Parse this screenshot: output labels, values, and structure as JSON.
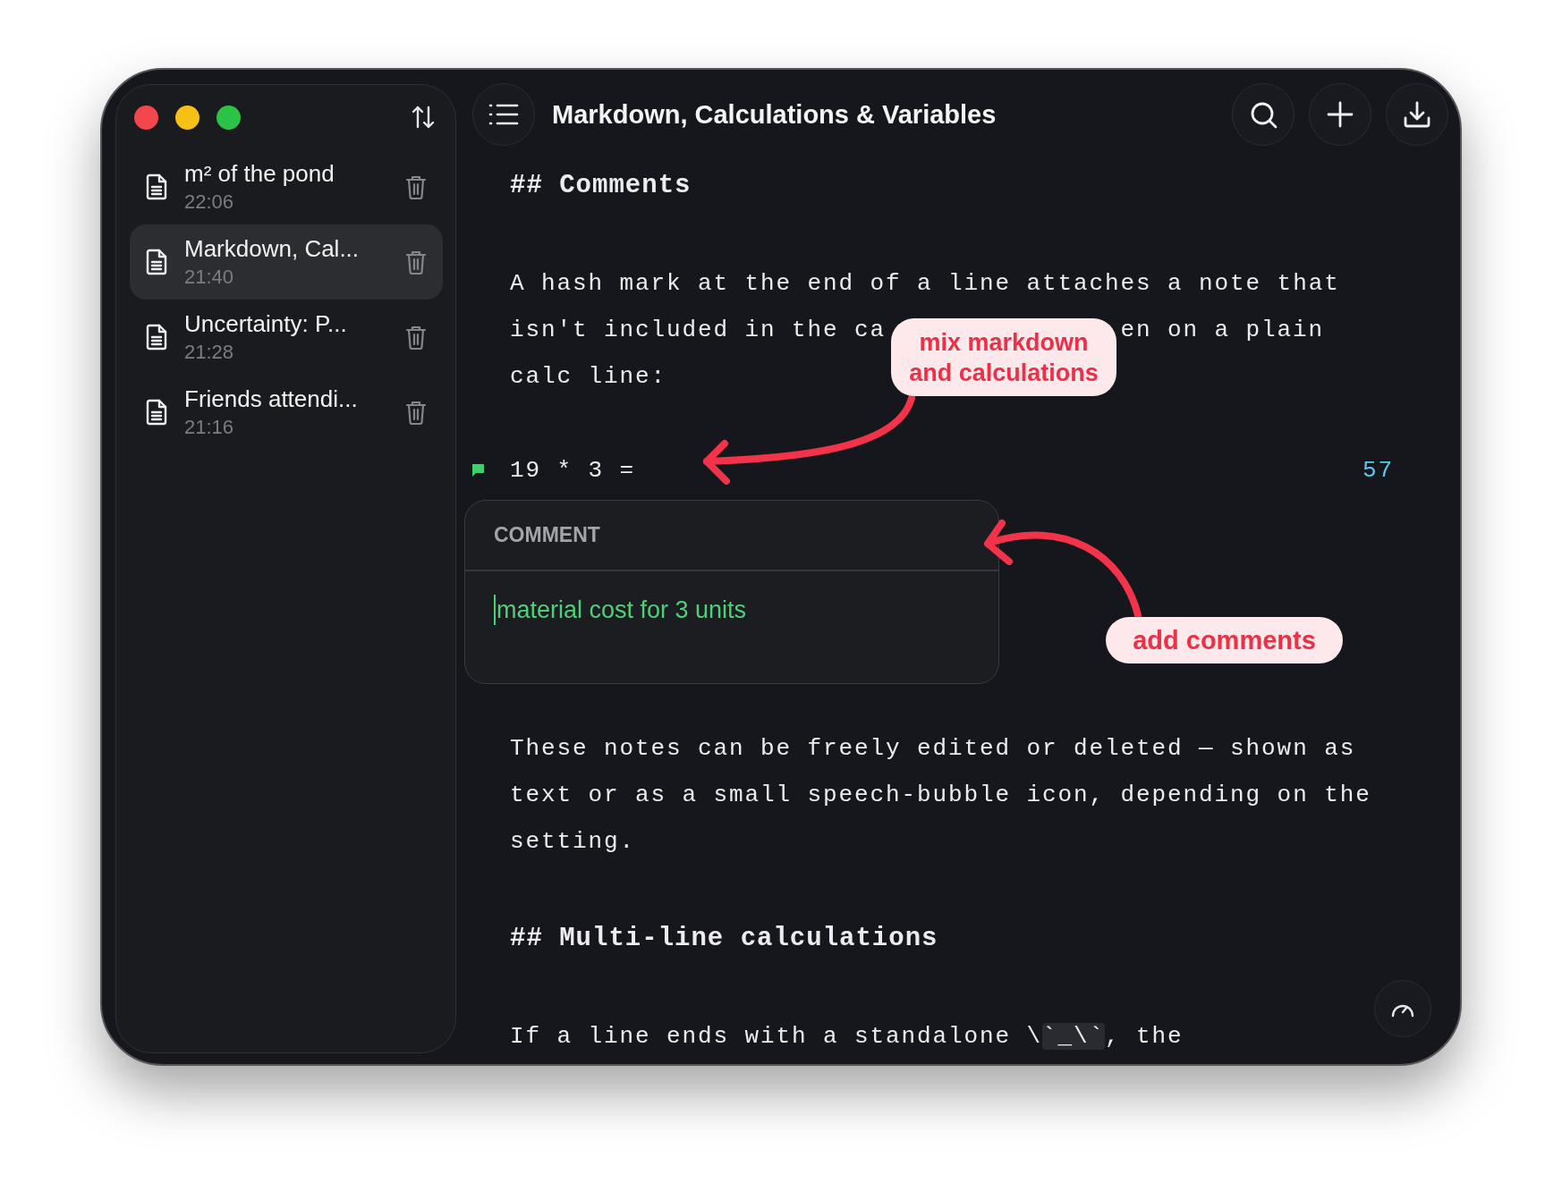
{
  "window_controls": [
    {
      "kind": "close"
    },
    {
      "kind": "minimize"
    },
    {
      "kind": "zoom"
    }
  ],
  "sidebar": {
    "notes": [
      {
        "title": "m² of the pond",
        "time": "22:06",
        "selected": false
      },
      {
        "title": "Markdown, Cal...",
        "time": "21:40",
        "selected": true
      },
      {
        "title": "Uncertainty: P...",
        "time": "21:28",
        "selected": false
      },
      {
        "title": "Friends attendi...",
        "time": "21:16",
        "selected": false
      }
    ]
  },
  "header": {
    "title": "Markdown, Calculations & Variables"
  },
  "document": {
    "blocks": [
      {
        "kind": "heading",
        "text": "## Comments"
      },
      {
        "kind": "paragraph",
        "lines": [
          [
            {
              "text": "A hash mark at the end of a line attaches a note that"
            }
          ],
          [
            {
              "text": "isn't included in the ca"
            },
            {
              "text": "en on a plain",
              "kind": "after_callout"
            }
          ],
          [
            {
              "text": "calc line:"
            }
          ]
        ]
      },
      {
        "kind": "calc",
        "expression": "19 * 3 =",
        "result": "57",
        "has_comment": true
      },
      {
        "kind": "comment_popup",
        "label": "COMMENT",
        "value": "material cost for 3 units"
      },
      {
        "kind": "paragraph",
        "lines": [
          [
            {
              "text": "These notes can be freely edited or deleted — shown as"
            }
          ],
          [
            {
              "text": "text or as a small speech-bubble icon, depending on the"
            }
          ],
          [
            {
              "text": "setting."
            }
          ]
        ]
      },
      {
        "kind": "heading",
        "text": "## Multi-line calculations"
      },
      {
        "kind": "paragraph",
        "lines": [
          [
            {
              "text": "If a line ends with a standalone \\"
            },
            {
              "text": "`_\\`",
              "kind": "code"
            },
            {
              "text": ", the"
            }
          ]
        ]
      }
    ]
  },
  "annotations": [
    {
      "text": "mix markdown\nand calculations"
    },
    {
      "text": "add comments"
    }
  ]
}
